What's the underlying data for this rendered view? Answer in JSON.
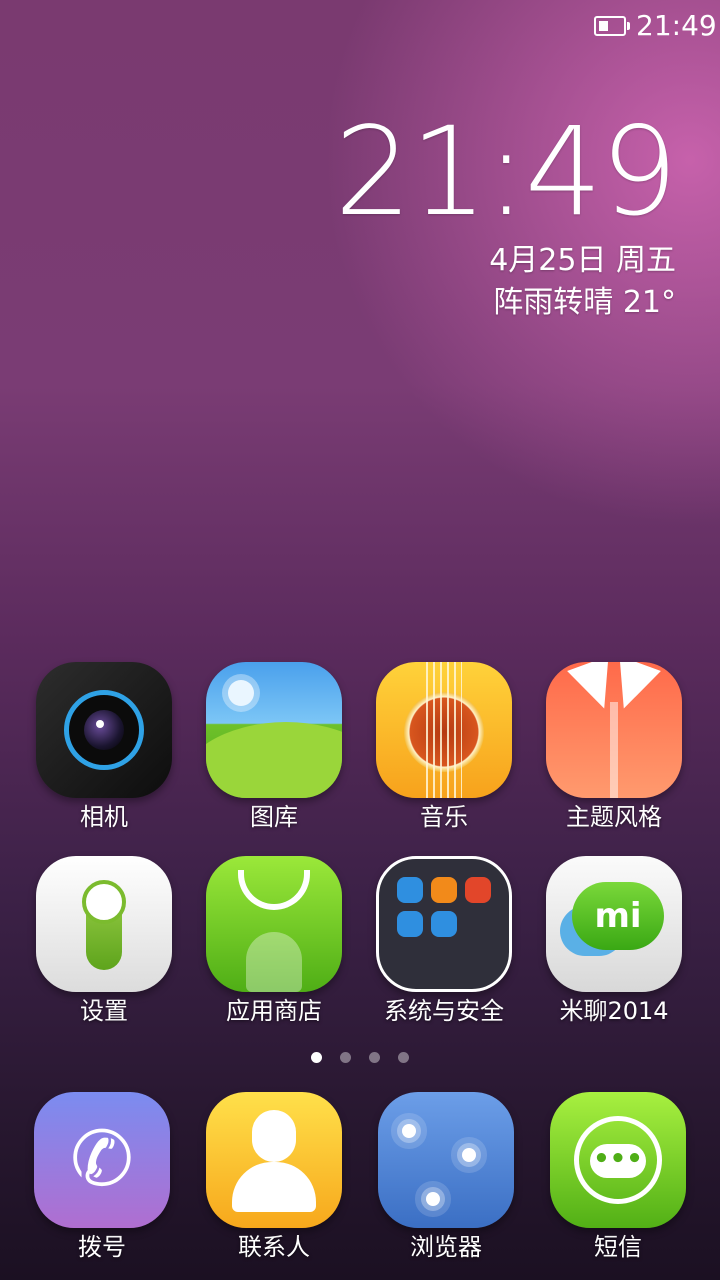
{
  "status_bar": {
    "time": "21:49",
    "battery_icon": "battery-icon"
  },
  "clock_widget": {
    "time": "21:49",
    "date": "4月25日 周五",
    "weather": "阵雨转晴  21°"
  },
  "apps_row1": [
    {
      "label": "相机",
      "icon": "camera-icon"
    },
    {
      "label": "图库",
      "icon": "gallery-icon"
    },
    {
      "label": "音乐",
      "icon": "music-icon"
    },
    {
      "label": "主题风格",
      "icon": "theme-icon"
    }
  ],
  "apps_row2": [
    {
      "label": "设置",
      "icon": "settings-icon"
    },
    {
      "label": "应用商店",
      "icon": "app-store-icon"
    },
    {
      "label": "系统与安全",
      "icon": "folder-icon"
    },
    {
      "label": "米聊2014",
      "icon": "mitalk-icon",
      "badge_text": "mi"
    }
  ],
  "page_indicator": {
    "pages": 4,
    "active": 1
  },
  "dock": [
    {
      "label": "拨号",
      "icon": "phone-icon"
    },
    {
      "label": "联系人",
      "icon": "contacts-icon"
    },
    {
      "label": "浏览器",
      "icon": "browser-icon"
    },
    {
      "label": "短信",
      "icon": "messages-icon"
    }
  ],
  "colors": {
    "accent_green": "#6cc424",
    "camera_ring": "#2fa2e6",
    "wallpaper_top": "#7a3a70",
    "wallpaper_bottom": "#1b1022"
  }
}
